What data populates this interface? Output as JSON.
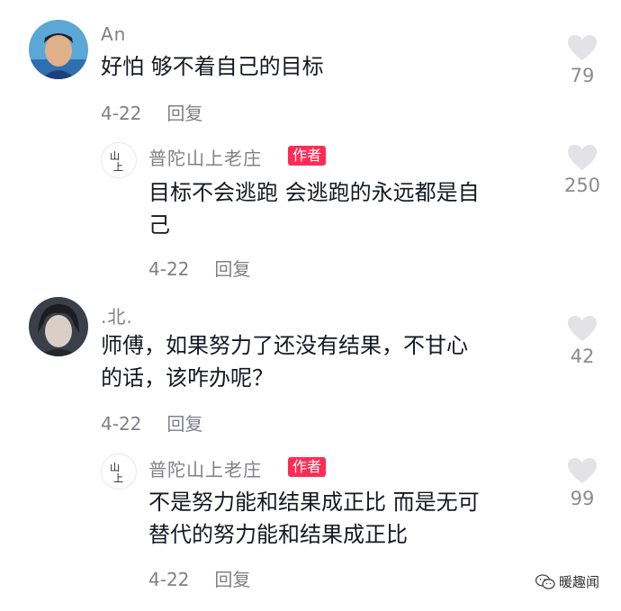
{
  "comments": [
    {
      "username": "An",
      "text_lines": [
        "好怕 够不着自己的目标"
      ],
      "date": "4-22",
      "reply_label": "回复",
      "likes": "79",
      "reply": {
        "username": "普陀山上老庄",
        "badge": "作者",
        "text_lines": [
          "目标不会逃跑 会逃跑的永远都是自",
          "己"
        ],
        "date": "4-22",
        "reply_label": "回复",
        "likes": "250"
      }
    },
    {
      "username": ".北.",
      "text_lines": [
        "师傅，如果努力了还没有结果，不甘心",
        "的话，该咋办呢？"
      ],
      "date": "4-22",
      "reply_label": "回复",
      "likes": "42",
      "reply": {
        "username": "普陀山上老庄",
        "badge": "作者",
        "text_lines": [
          "不是努力能和结果成正比 而是无可",
          "替代的努力能和结果成正比"
        ],
        "date": "4-22",
        "reply_label": "回复",
        "likes": "99"
      }
    }
  ],
  "watermark": "暖趣闻",
  "colors": {
    "badge": "#fe2c55",
    "secondary_text": "#7f8087",
    "heart": "#e3e3e6"
  }
}
